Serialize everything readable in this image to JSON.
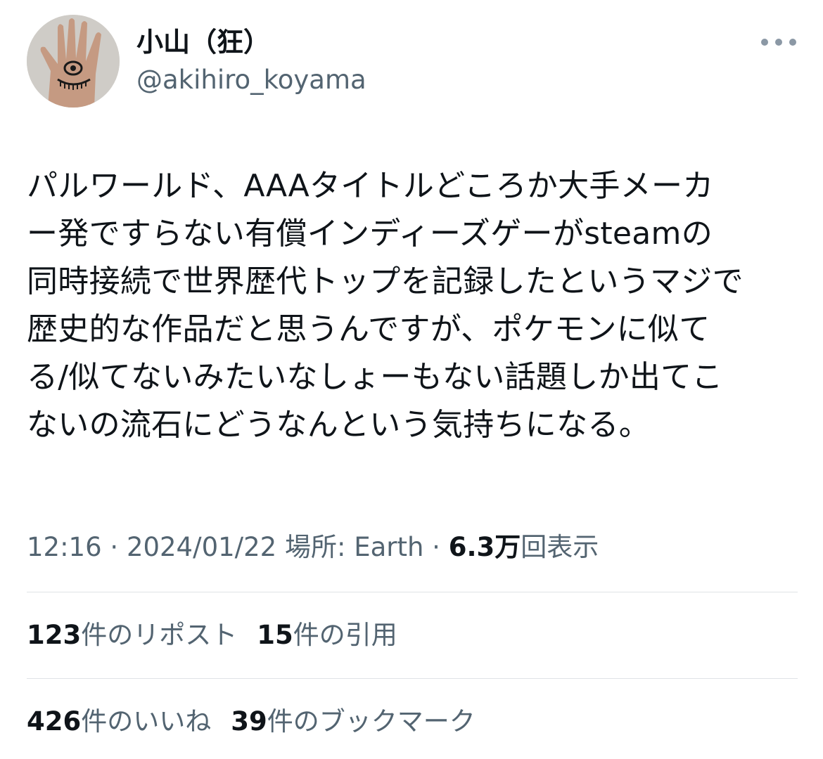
{
  "user": {
    "display_name": "小山（狂）",
    "handle": "@akihiro_koyama",
    "avatar_icon": "hand-with-eye-avatar"
  },
  "more_icon": "more-horizontal-icon",
  "tweet": {
    "text": "パルワールド、AAAタイトルどころか大手メーカ\nー発ですらない有償インディーズゲーがsteamの\n同時接続で世界歴代トップを記録したというマジで\n歴史的な作品だと思うんですが、ポケモンに似て\nる/似てないみたいなしょーもない話題しか出てこ\nないの流石にどうなんという気持ちになる。"
  },
  "meta": {
    "time": "12:16",
    "sep1": " · ",
    "date": "2024/01/22",
    "location": " 場所: Earth",
    "sep2": " · ",
    "views_count": "6.3万",
    "views_label": "回表示"
  },
  "stats": {
    "reposts": {
      "count": "123",
      "label": "件のリポスト"
    },
    "quotes": {
      "count": "15",
      "label": "件の引用"
    },
    "likes": {
      "count": "426",
      "label": "件のいいね"
    },
    "bookmarks": {
      "count": "39",
      "label": "件のブックマーク"
    }
  },
  "colors": {
    "text": "#0f1419",
    "secondary": "#536471",
    "divider": "#dfe3e6"
  }
}
